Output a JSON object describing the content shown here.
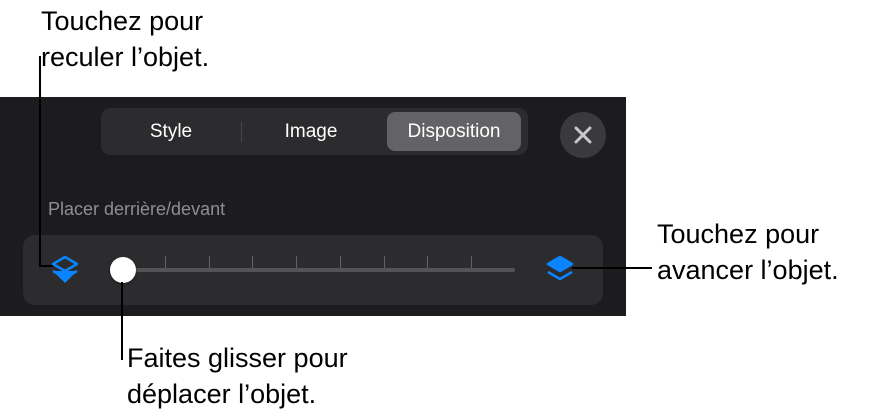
{
  "callouts": {
    "top": [
      "Touchez pour",
      "reculer l’objet."
    ],
    "right": [
      "Touchez pour",
      "avancer l’objet."
    ],
    "bottom": [
      "Faites glisser pour",
      "déplacer l’objet."
    ]
  },
  "tabs": [
    {
      "label": "Style",
      "selected": false
    },
    {
      "label": "Image",
      "selected": false
    },
    {
      "label": "Disposition",
      "selected": true
    }
  ],
  "close_icon": "close-icon",
  "arrange": {
    "label": "Placer derrière/devant",
    "back_icon": "layer-back-icon",
    "front_icon": "layer-front-icon",
    "slider_value": 0,
    "slider_steps": 9
  },
  "colors": {
    "panel": "#1c1c1e",
    "accent": "#0a84ff",
    "selected_tab": "#636366"
  }
}
